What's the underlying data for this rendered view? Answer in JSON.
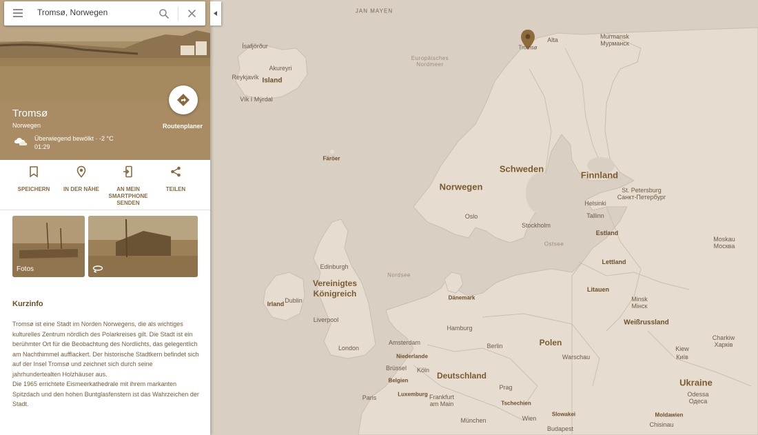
{
  "search": {
    "value": "Tromsø, Norwegen"
  },
  "place": {
    "name": "Tromsø",
    "country": "Norwegen",
    "weather": "Überwiegend bewölkt · -2 °C",
    "time": "01:29",
    "route_label": "Routenplaner"
  },
  "actions": [
    {
      "label": "SPEICHERN",
      "icon": "bookmark-icon"
    },
    {
      "label": "IN DER NÄHE",
      "icon": "nearby-icon"
    },
    {
      "label": "AN MEIN SMARTPHONE SENDEN",
      "icon": "send-to-phone-icon"
    },
    {
      "label": "TEILEN",
      "icon": "share-icon"
    }
  ],
  "photos": {
    "label": "Fotos"
  },
  "info": {
    "heading": "Kurzinfo",
    "text": "Tromsø ist eine Stadt im Norden Norwegens, die als wichtiges kulturelles Zentrum nördlich des Polarkreises gilt. Die Stadt ist ein berühmter Ort für die Beobachtung des Nordlichts, das gelegentlich am Nachthimmel aufflackert. Der historische Stadtkern befindet sich auf der Insel Tromsø und zeichnet sich durch seine jahrhundertealten Holzhäuser aus.\nDie 1965 errichtete Eismeerkathedrale mit ihrem markanten Spitzdach und den hohen Buntglasfenstern ist das Wahrzeichen der Stadt."
  },
  "colors": {
    "accent": "#8a6a3c",
    "panel_header": "#a98c63",
    "map_land": "#e6ddd0",
    "map_water": "#d6cbbd"
  },
  "map": {
    "marker_label": "Tromsø",
    "labels": {
      "jan_mayen": "JAN MAYEN",
      "isafjordur": "Ísafjörður",
      "akureyri": "Akureyri",
      "reykjavik": "Reykjavík",
      "island": "Island",
      "vik": "Vík í Mýrdal",
      "nordmeer": "Europäisches Nordmeer",
      "alta": "Alta",
      "murmansk": "Murmansk",
      "murmansk_ru": "Мурманск",
      "faroer": "Färöer",
      "schweden": "Schweden",
      "finnland": "Finnland",
      "norwegen": "Norwegen",
      "st_petersburg": "St. Petersburg",
      "st_petersburg_ru": "Санкт-Петербург",
      "oslo": "Oslo",
      "stockholm": "Stockholm",
      "helsinki": "Helsinki",
      "tallinn": "Tallinn",
      "ostsee": "Ostsee",
      "estland": "Estland",
      "moskau": "Moskau",
      "moskau_ru": "Москва",
      "edinburgh": "Edinburgh",
      "lettland": "Lettland",
      "nordsee": "Nordsee",
      "vk1": "Vereinigtes",
      "vk2": "Königreich",
      "irland": "Irland",
      "dublin": "Dublin",
      "litauen": "Litauen",
      "daenemark": "Dänemark",
      "minsk": "Minsk",
      "minsk_ru": "Мінск",
      "liverpool": "Liverpool",
      "weissrussland": "Weißrussland",
      "hamburg": "Hamburg",
      "amsterdam": "Amsterdam",
      "berlin": "Berlin",
      "polen": "Polen",
      "charkiw": "Charkiw",
      "charkiw_ua": "Харків",
      "london": "London",
      "kiew": "Kiew",
      "kiew_ua": "Київ",
      "niederlande": "Niederlande",
      "warschau": "Warschau",
      "bruessel": "Brüssel",
      "koeln": "Köln",
      "belgien": "Belgien",
      "deutschland": "Deutschland",
      "ukraine": "Ukraine",
      "luxemburg": "Luxemburg",
      "prag": "Prag",
      "paris": "Paris",
      "frankfurt": "Frankfurt am Main",
      "tschechien": "Tschechien",
      "odessa": "Odessa",
      "odessa_ua": "Одеса",
      "slowakei": "Slowakei",
      "moldawien": "Moldawien",
      "muenchen": "München",
      "wien": "Wien",
      "chisinau": "Chisinau",
      "budapest": "Budapest"
    }
  }
}
